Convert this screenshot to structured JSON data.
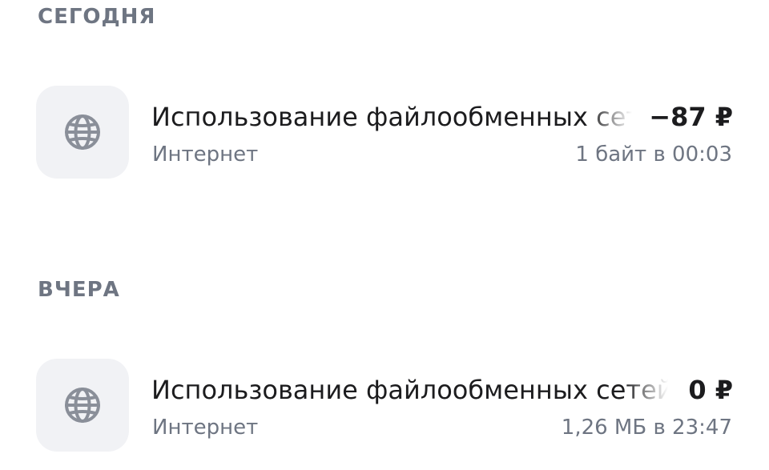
{
  "sections": [
    {
      "header": "СЕГОДНЯ",
      "transactions": [
        {
          "title": "Использование файлообменных сетей",
          "amount": "−87 ₽",
          "category": "Интернет",
          "meta": "1 байт в 00:03",
          "icon": "globe-icon"
        }
      ]
    },
    {
      "header": "ВЧЕРА",
      "transactions": [
        {
          "title": "Использование файлообменных сетей",
          "amount": "0 ₽",
          "category": "Интернет",
          "meta": "1,26 МБ в 23:47",
          "icon": "globe-icon"
        }
      ]
    }
  ],
  "colors": {
    "header_text": "#6e7582",
    "primary_text": "#1c1c1e",
    "secondary_text": "#6e7582",
    "icon_background": "#f1f2f5",
    "icon_stroke": "#8a8f99"
  }
}
